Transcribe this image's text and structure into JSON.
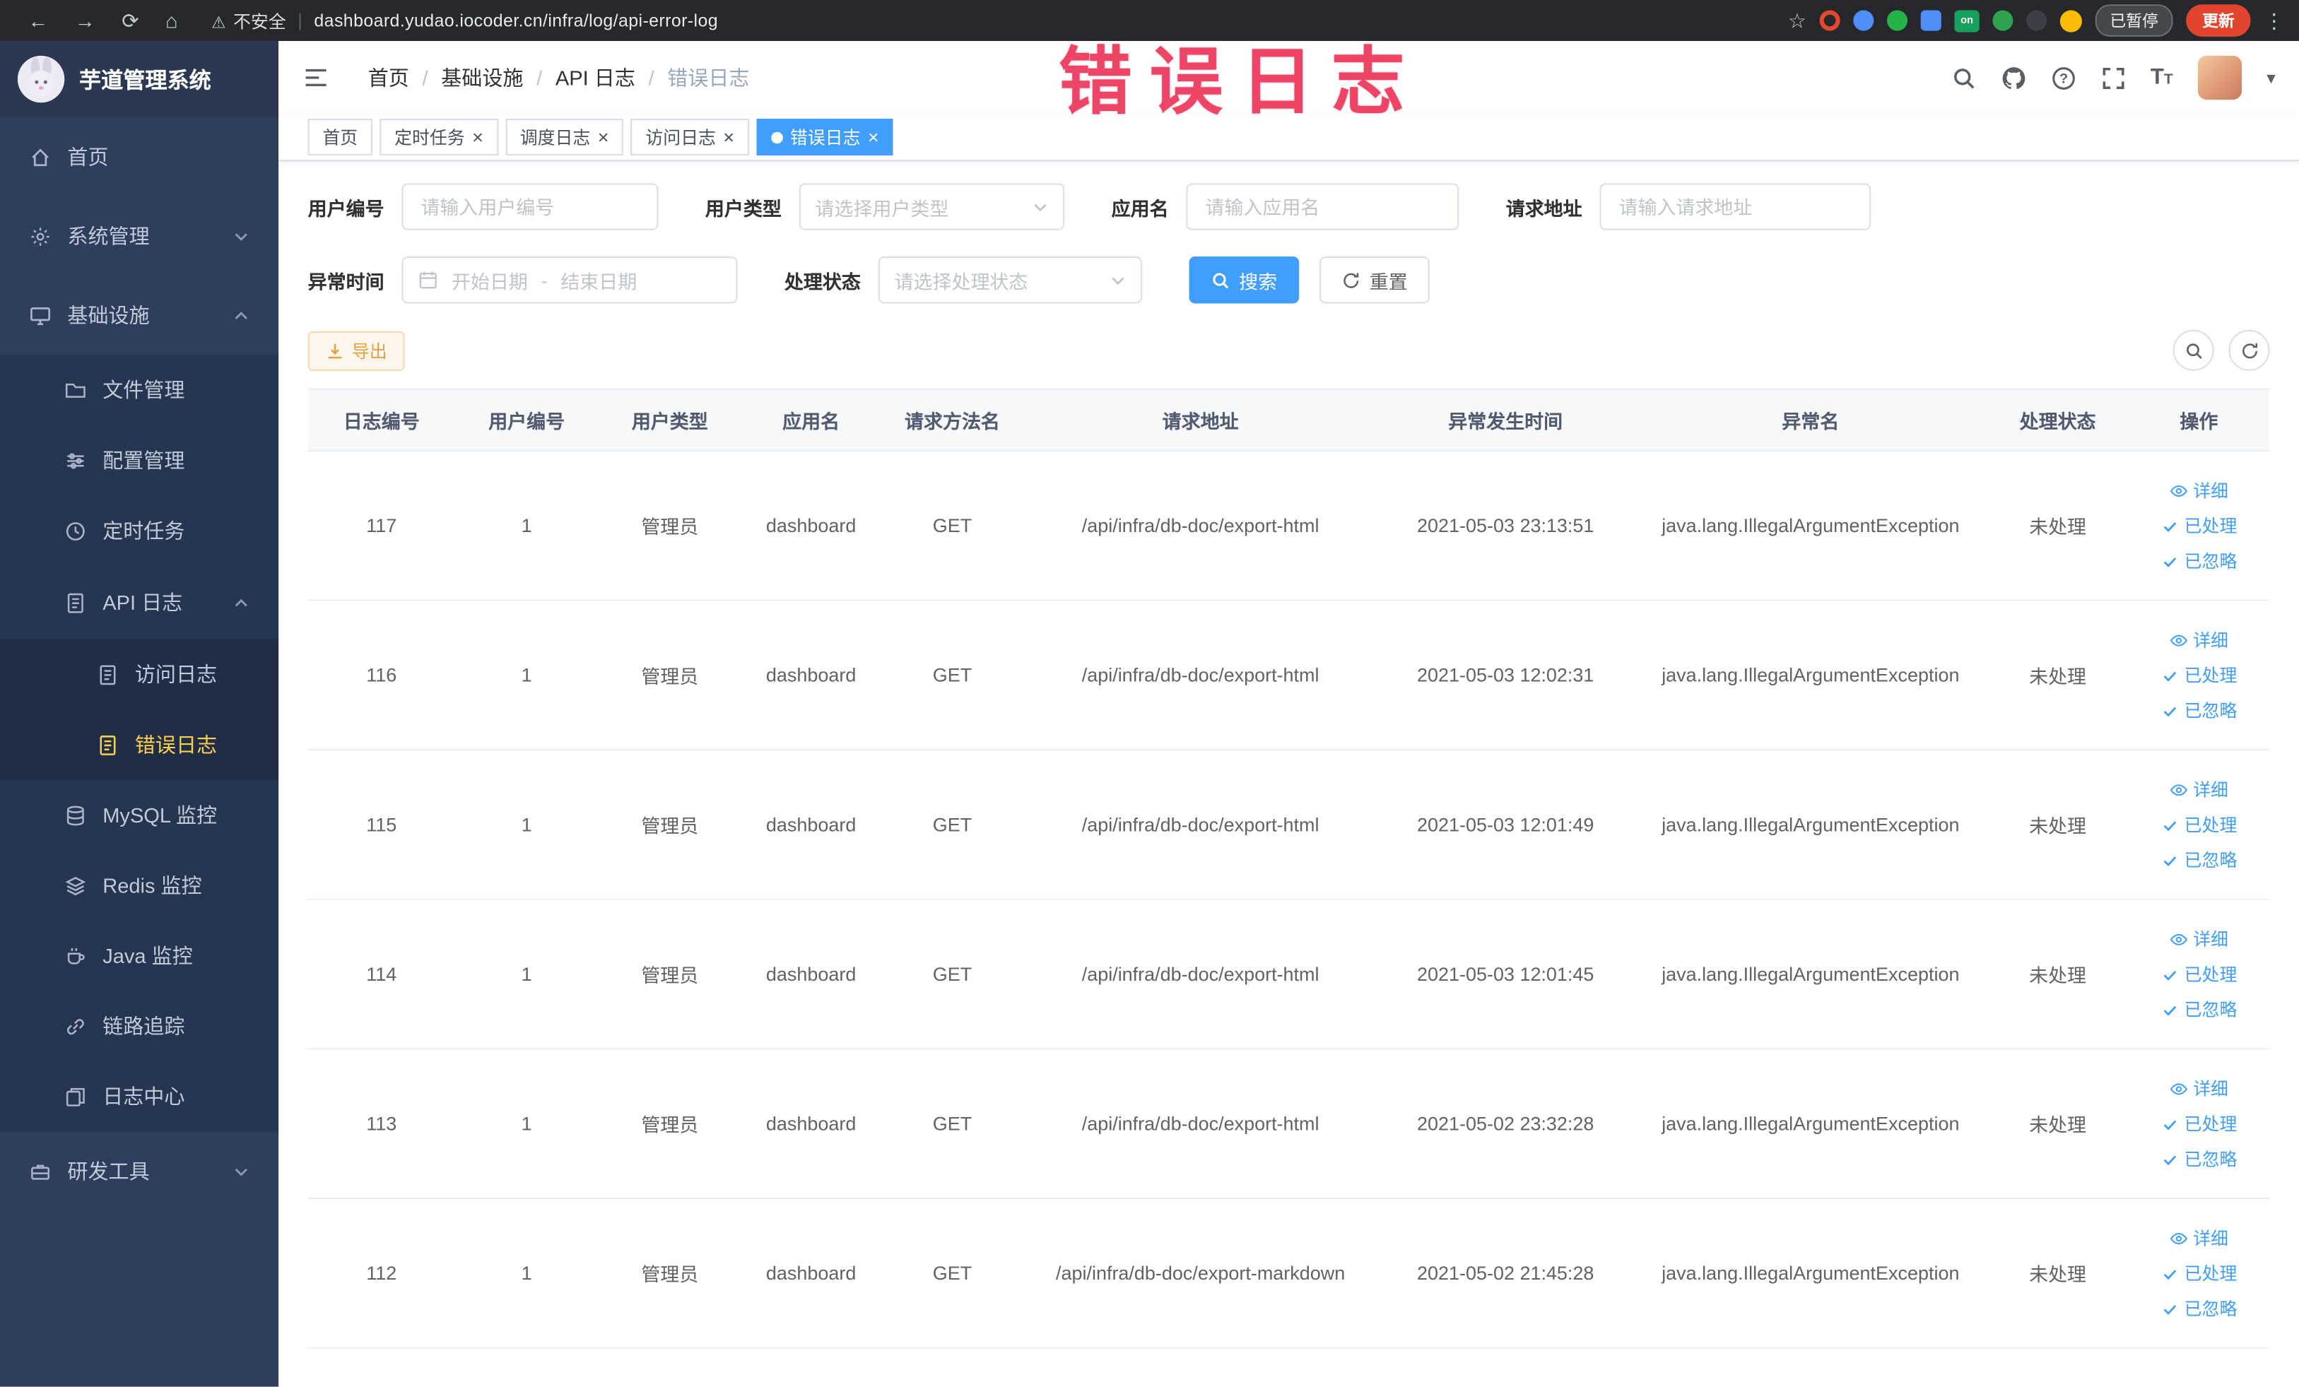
{
  "browser": {
    "security_label": "不安全",
    "url": "dashboard.yudao.iocoder.cn/infra/log/api-error-log",
    "ext_on_badge": "on",
    "paused_badge": "已暂停",
    "update_button": "更新"
  },
  "annotation": {
    "text": "错误日志",
    "color": "#ee4566"
  },
  "sidebar": {
    "logo_title": "芋道管理系统",
    "home": "首页",
    "system_mgmt": "系统管理",
    "infrastructure": "基础设施",
    "file_mgmt": "文件管理",
    "config_mgmt": "配置管理",
    "scheduled_jobs": "定时任务",
    "api_log": "API 日志",
    "access_log": "访问日志",
    "error_log": "错误日志",
    "mysql_monitor": "MySQL 监控",
    "redis_monitor": "Redis 监控",
    "java_monitor": "Java 监控",
    "tracing": "链路追踪",
    "log_center": "日志中心",
    "dev_tools": "研发工具"
  },
  "header": {
    "breadcrumb": [
      "首页",
      "基础设施",
      "API 日志",
      "错误日志"
    ]
  },
  "tabs": [
    {
      "label": "首页"
    },
    {
      "label": "定时任务"
    },
    {
      "label": "调度日志"
    },
    {
      "label": "访问日志"
    },
    {
      "label": "错误日志"
    }
  ],
  "filters": {
    "user_id_label": "用户编号",
    "user_id_placeholder": "请输入用户编号",
    "user_type_label": "用户类型",
    "user_type_placeholder": "请选择用户类型",
    "app_name_label": "应用名",
    "app_name_placeholder": "请输入应用名",
    "request_url_label": "请求地址",
    "request_url_placeholder": "请输入请求地址",
    "exception_time_label": "异常时间",
    "start_date_placeholder": "开始日期",
    "range_separator": "-",
    "end_date_placeholder": "结束日期",
    "status_label": "处理状态",
    "status_placeholder": "请选择处理状态",
    "search_button": "搜索",
    "reset_button": "重置"
  },
  "toolbar": {
    "export_button": "导出"
  },
  "table": {
    "columns": [
      "日志编号",
      "用户编号",
      "用户类型",
      "应用名",
      "请求方法名",
      "请求地址",
      "异常发生时间",
      "异常名",
      "处理状态",
      "操作"
    ],
    "actions": {
      "detail": "详细",
      "processed": "已处理",
      "ignored": "已忽略"
    },
    "rows": [
      {
        "id": "117",
        "user_id": "1",
        "user_type": "管理员",
        "app_name": "dashboard",
        "method": "GET",
        "url": "/api/infra/db-doc/export-html",
        "time": "2021-05-03 23:13:51",
        "exception": "java.lang.IllegalArgumentException",
        "status": "未处理"
      },
      {
        "id": "116",
        "user_id": "1",
        "user_type": "管理员",
        "app_name": "dashboard",
        "method": "GET",
        "url": "/api/infra/db-doc/export-html",
        "time": "2021-05-03 12:02:31",
        "exception": "java.lang.IllegalArgumentException",
        "status": "未处理"
      },
      {
        "id": "115",
        "user_id": "1",
        "user_type": "管理员",
        "app_name": "dashboard",
        "method": "GET",
        "url": "/api/infra/db-doc/export-html",
        "time": "2021-05-03 12:01:49",
        "exception": "java.lang.IllegalArgumentException",
        "status": "未处理"
      },
      {
        "id": "114",
        "user_id": "1",
        "user_type": "管理员",
        "app_name": "dashboard",
        "method": "GET",
        "url": "/api/infra/db-doc/export-html",
        "time": "2021-05-03 12:01:45",
        "exception": "java.lang.IllegalArgumentException",
        "status": "未处理"
      },
      {
        "id": "113",
        "user_id": "1",
        "user_type": "管理员",
        "app_name": "dashboard",
        "method": "GET",
        "url": "/api/infra/db-doc/export-html",
        "time": "2021-05-02 23:32:28",
        "exception": "java.lang.IllegalArgumentException",
        "status": "未处理"
      },
      {
        "id": "112",
        "user_id": "1",
        "user_type": "管理员",
        "app_name": "dashboard",
        "method": "GET",
        "url": "/api/infra/db-doc/export-markdown",
        "time": "2021-05-02 21:45:28",
        "exception": "java.lang.IllegalArgumentException",
        "status": "未处理"
      }
    ]
  }
}
